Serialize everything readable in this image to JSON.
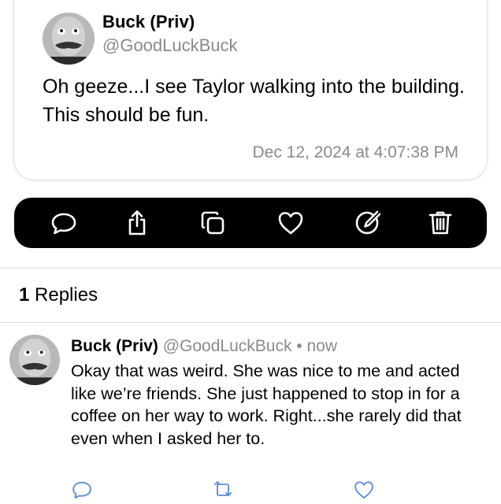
{
  "post": {
    "author_name": "Buck (Priv)",
    "author_handle": "@GoodLuckBuck",
    "text": "Oh geeze...I see Taylor walking into the building. This should be fun.",
    "timestamp": "Dec 12, 2024 at 4:07:38 PM"
  },
  "action_bar": {
    "buttons": [
      {
        "icon": "speech-bubble-icon"
      },
      {
        "icon": "share-icon"
      },
      {
        "icon": "copy-icon"
      },
      {
        "icon": "heart-icon"
      },
      {
        "icon": "edit-icon"
      },
      {
        "icon": "trash-icon"
      }
    ],
    "background": "#000000",
    "icon_color": "#ffffff"
  },
  "replies": {
    "count": "1",
    "label": "Replies",
    "items": [
      {
        "author_name": "Buck (Priv)",
        "author_handle": "@GoodLuckBuck",
        "separator": "•",
        "time": "now",
        "text": "Okay that was weird. She was nice to me and acted like we’re friends. She just happened to stop in for a coffee on her way to work. Right...she rarely did that even when I asked her to.",
        "actions": [
          "reply-icon",
          "repost-icon",
          "like-icon"
        ]
      }
    ]
  },
  "colors": {
    "secondary_text": "#8a8a8e",
    "divider": "#dcdcdc",
    "reply_action_icons": "#5b8fd6"
  }
}
